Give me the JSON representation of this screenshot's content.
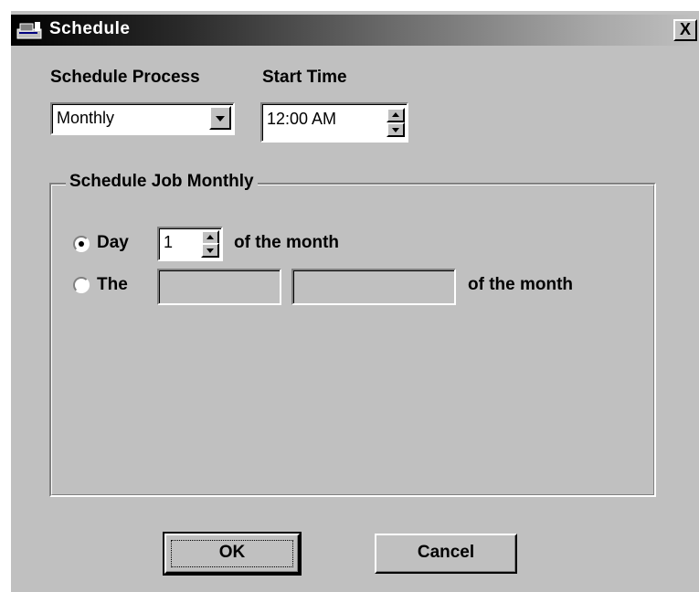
{
  "window": {
    "title": "Schedule",
    "icon": "app-window-icon",
    "close_label": "X"
  },
  "schedule_process": {
    "label": "Schedule Process",
    "selected": "Monthly"
  },
  "start_time": {
    "label": "Start Time",
    "value": "12:00 AM"
  },
  "group": {
    "title": "Schedule Job Monthly",
    "day_option": {
      "label": "Day",
      "selected": true,
      "value": "1",
      "suffix": "of the month"
    },
    "the_option": {
      "label": "The",
      "selected": false,
      "field1": "",
      "field2": "",
      "suffix": "of the month"
    }
  },
  "buttons": {
    "ok": "OK",
    "cancel": "Cancel"
  },
  "colors": {
    "dialog_bg": "#c0c0c0",
    "title_start": "#000000",
    "title_end": "#c0c0c0"
  }
}
